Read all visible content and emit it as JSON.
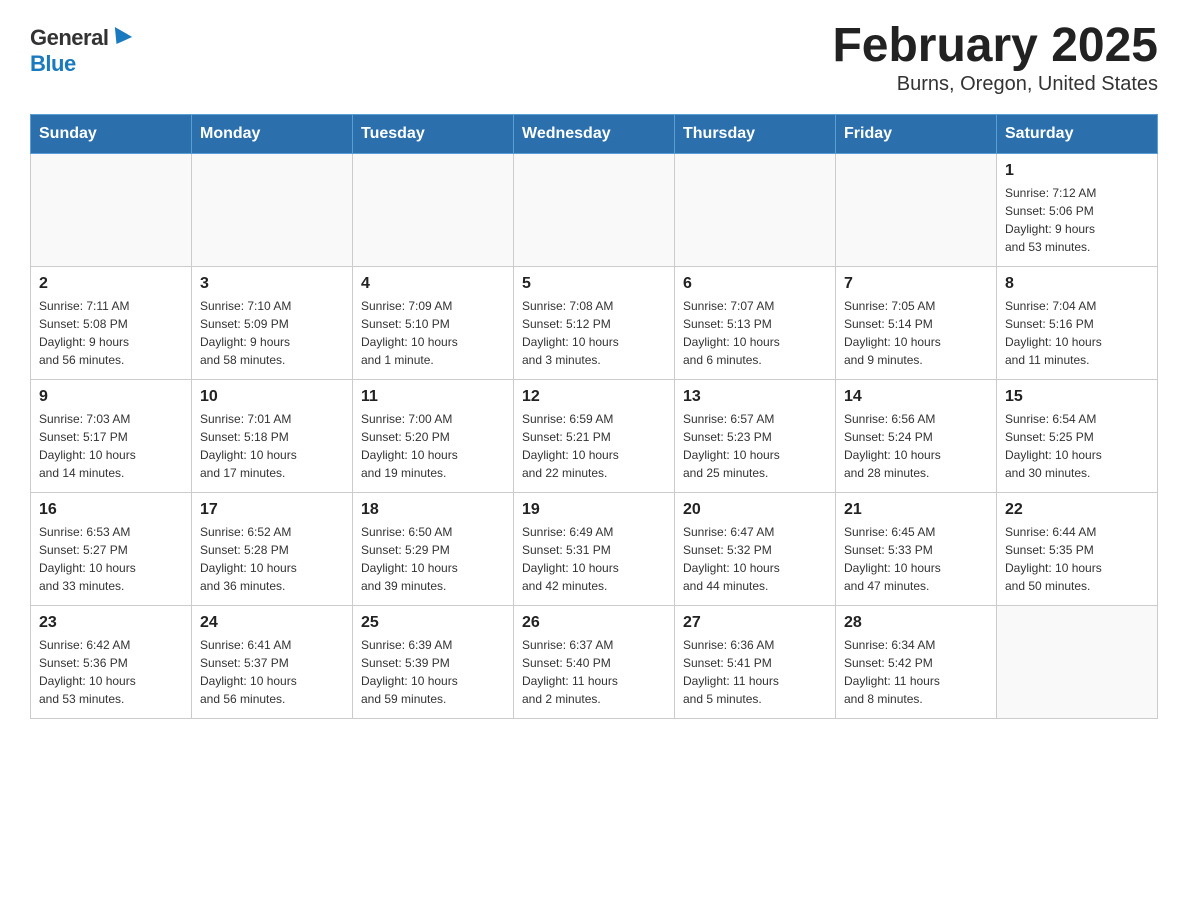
{
  "header": {
    "logo_general": "General",
    "logo_blue": "Blue",
    "title": "February 2025",
    "subtitle": "Burns, Oregon, United States"
  },
  "days_of_week": [
    "Sunday",
    "Monday",
    "Tuesday",
    "Wednesday",
    "Thursday",
    "Friday",
    "Saturday"
  ],
  "weeks": [
    [
      {
        "day": "",
        "info": ""
      },
      {
        "day": "",
        "info": ""
      },
      {
        "day": "",
        "info": ""
      },
      {
        "day": "",
        "info": ""
      },
      {
        "day": "",
        "info": ""
      },
      {
        "day": "",
        "info": ""
      },
      {
        "day": "1",
        "info": "Sunrise: 7:12 AM\nSunset: 5:06 PM\nDaylight: 9 hours\nand 53 minutes."
      }
    ],
    [
      {
        "day": "2",
        "info": "Sunrise: 7:11 AM\nSunset: 5:08 PM\nDaylight: 9 hours\nand 56 minutes."
      },
      {
        "day": "3",
        "info": "Sunrise: 7:10 AM\nSunset: 5:09 PM\nDaylight: 9 hours\nand 58 minutes."
      },
      {
        "day": "4",
        "info": "Sunrise: 7:09 AM\nSunset: 5:10 PM\nDaylight: 10 hours\nand 1 minute."
      },
      {
        "day": "5",
        "info": "Sunrise: 7:08 AM\nSunset: 5:12 PM\nDaylight: 10 hours\nand 3 minutes."
      },
      {
        "day": "6",
        "info": "Sunrise: 7:07 AM\nSunset: 5:13 PM\nDaylight: 10 hours\nand 6 minutes."
      },
      {
        "day": "7",
        "info": "Sunrise: 7:05 AM\nSunset: 5:14 PM\nDaylight: 10 hours\nand 9 minutes."
      },
      {
        "day": "8",
        "info": "Sunrise: 7:04 AM\nSunset: 5:16 PM\nDaylight: 10 hours\nand 11 minutes."
      }
    ],
    [
      {
        "day": "9",
        "info": "Sunrise: 7:03 AM\nSunset: 5:17 PM\nDaylight: 10 hours\nand 14 minutes."
      },
      {
        "day": "10",
        "info": "Sunrise: 7:01 AM\nSunset: 5:18 PM\nDaylight: 10 hours\nand 17 minutes."
      },
      {
        "day": "11",
        "info": "Sunrise: 7:00 AM\nSunset: 5:20 PM\nDaylight: 10 hours\nand 19 minutes."
      },
      {
        "day": "12",
        "info": "Sunrise: 6:59 AM\nSunset: 5:21 PM\nDaylight: 10 hours\nand 22 minutes."
      },
      {
        "day": "13",
        "info": "Sunrise: 6:57 AM\nSunset: 5:23 PM\nDaylight: 10 hours\nand 25 minutes."
      },
      {
        "day": "14",
        "info": "Sunrise: 6:56 AM\nSunset: 5:24 PM\nDaylight: 10 hours\nand 28 minutes."
      },
      {
        "day": "15",
        "info": "Sunrise: 6:54 AM\nSunset: 5:25 PM\nDaylight: 10 hours\nand 30 minutes."
      }
    ],
    [
      {
        "day": "16",
        "info": "Sunrise: 6:53 AM\nSunset: 5:27 PM\nDaylight: 10 hours\nand 33 minutes."
      },
      {
        "day": "17",
        "info": "Sunrise: 6:52 AM\nSunset: 5:28 PM\nDaylight: 10 hours\nand 36 minutes."
      },
      {
        "day": "18",
        "info": "Sunrise: 6:50 AM\nSunset: 5:29 PM\nDaylight: 10 hours\nand 39 minutes."
      },
      {
        "day": "19",
        "info": "Sunrise: 6:49 AM\nSunset: 5:31 PM\nDaylight: 10 hours\nand 42 minutes."
      },
      {
        "day": "20",
        "info": "Sunrise: 6:47 AM\nSunset: 5:32 PM\nDaylight: 10 hours\nand 44 minutes."
      },
      {
        "day": "21",
        "info": "Sunrise: 6:45 AM\nSunset: 5:33 PM\nDaylight: 10 hours\nand 47 minutes."
      },
      {
        "day": "22",
        "info": "Sunrise: 6:44 AM\nSunset: 5:35 PM\nDaylight: 10 hours\nand 50 minutes."
      }
    ],
    [
      {
        "day": "23",
        "info": "Sunrise: 6:42 AM\nSunset: 5:36 PM\nDaylight: 10 hours\nand 53 minutes."
      },
      {
        "day": "24",
        "info": "Sunrise: 6:41 AM\nSunset: 5:37 PM\nDaylight: 10 hours\nand 56 minutes."
      },
      {
        "day": "25",
        "info": "Sunrise: 6:39 AM\nSunset: 5:39 PM\nDaylight: 10 hours\nand 59 minutes."
      },
      {
        "day": "26",
        "info": "Sunrise: 6:37 AM\nSunset: 5:40 PM\nDaylight: 11 hours\nand 2 minutes."
      },
      {
        "day": "27",
        "info": "Sunrise: 6:36 AM\nSunset: 5:41 PM\nDaylight: 11 hours\nand 5 minutes."
      },
      {
        "day": "28",
        "info": "Sunrise: 6:34 AM\nSunset: 5:42 PM\nDaylight: 11 hours\nand 8 minutes."
      },
      {
        "day": "",
        "info": ""
      }
    ]
  ]
}
